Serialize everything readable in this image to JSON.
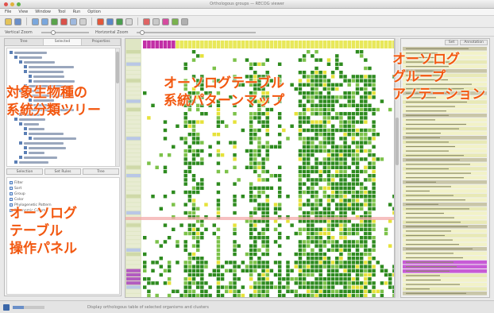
{
  "window": {
    "title": "Orthologous groups — RECOG viewer"
  },
  "menu": [
    "File",
    "View",
    "Window",
    "Tool",
    "Run",
    "Option"
  ],
  "sliders": {
    "left_label": "Vertical Zoom",
    "right_label": "Horizontal Zoom"
  },
  "left_panel": {
    "tabs": [
      "Tree",
      "Selected",
      "Properties"
    ],
    "control_tabs": [
      "Selection",
      "Set Rules",
      "Tree"
    ],
    "control_items": [
      "Filter",
      "Sort",
      "Group",
      "Color",
      "Phylogenetic Pattern",
      "Taxonomic Column"
    ]
  },
  "right_panel": {
    "buttons": [
      "Set",
      "Annotation"
    ]
  },
  "status": {
    "message": "Display orthologous table of selected organisms and clusters",
    "progress": 0.35
  },
  "callouts": {
    "tree": "対象生物種の\n系統分類ツリー",
    "matrix": "オーソログテーブル\n系統パターンマップ",
    "annotation": "オーソログ\nグループ\nアノテーション",
    "panel": "オーソログ\nテーブル\n操作パネル"
  },
  "colors": {
    "cell_dark": "#2e8b1f",
    "cell_light": "#7cc24a",
    "cell_yellow": "#e6e23a",
    "header_magenta": "#c22fa6",
    "header_yellow": "#e8e85a",
    "highlight_row": "#f2a5a5",
    "callout": "#f2570f"
  }
}
